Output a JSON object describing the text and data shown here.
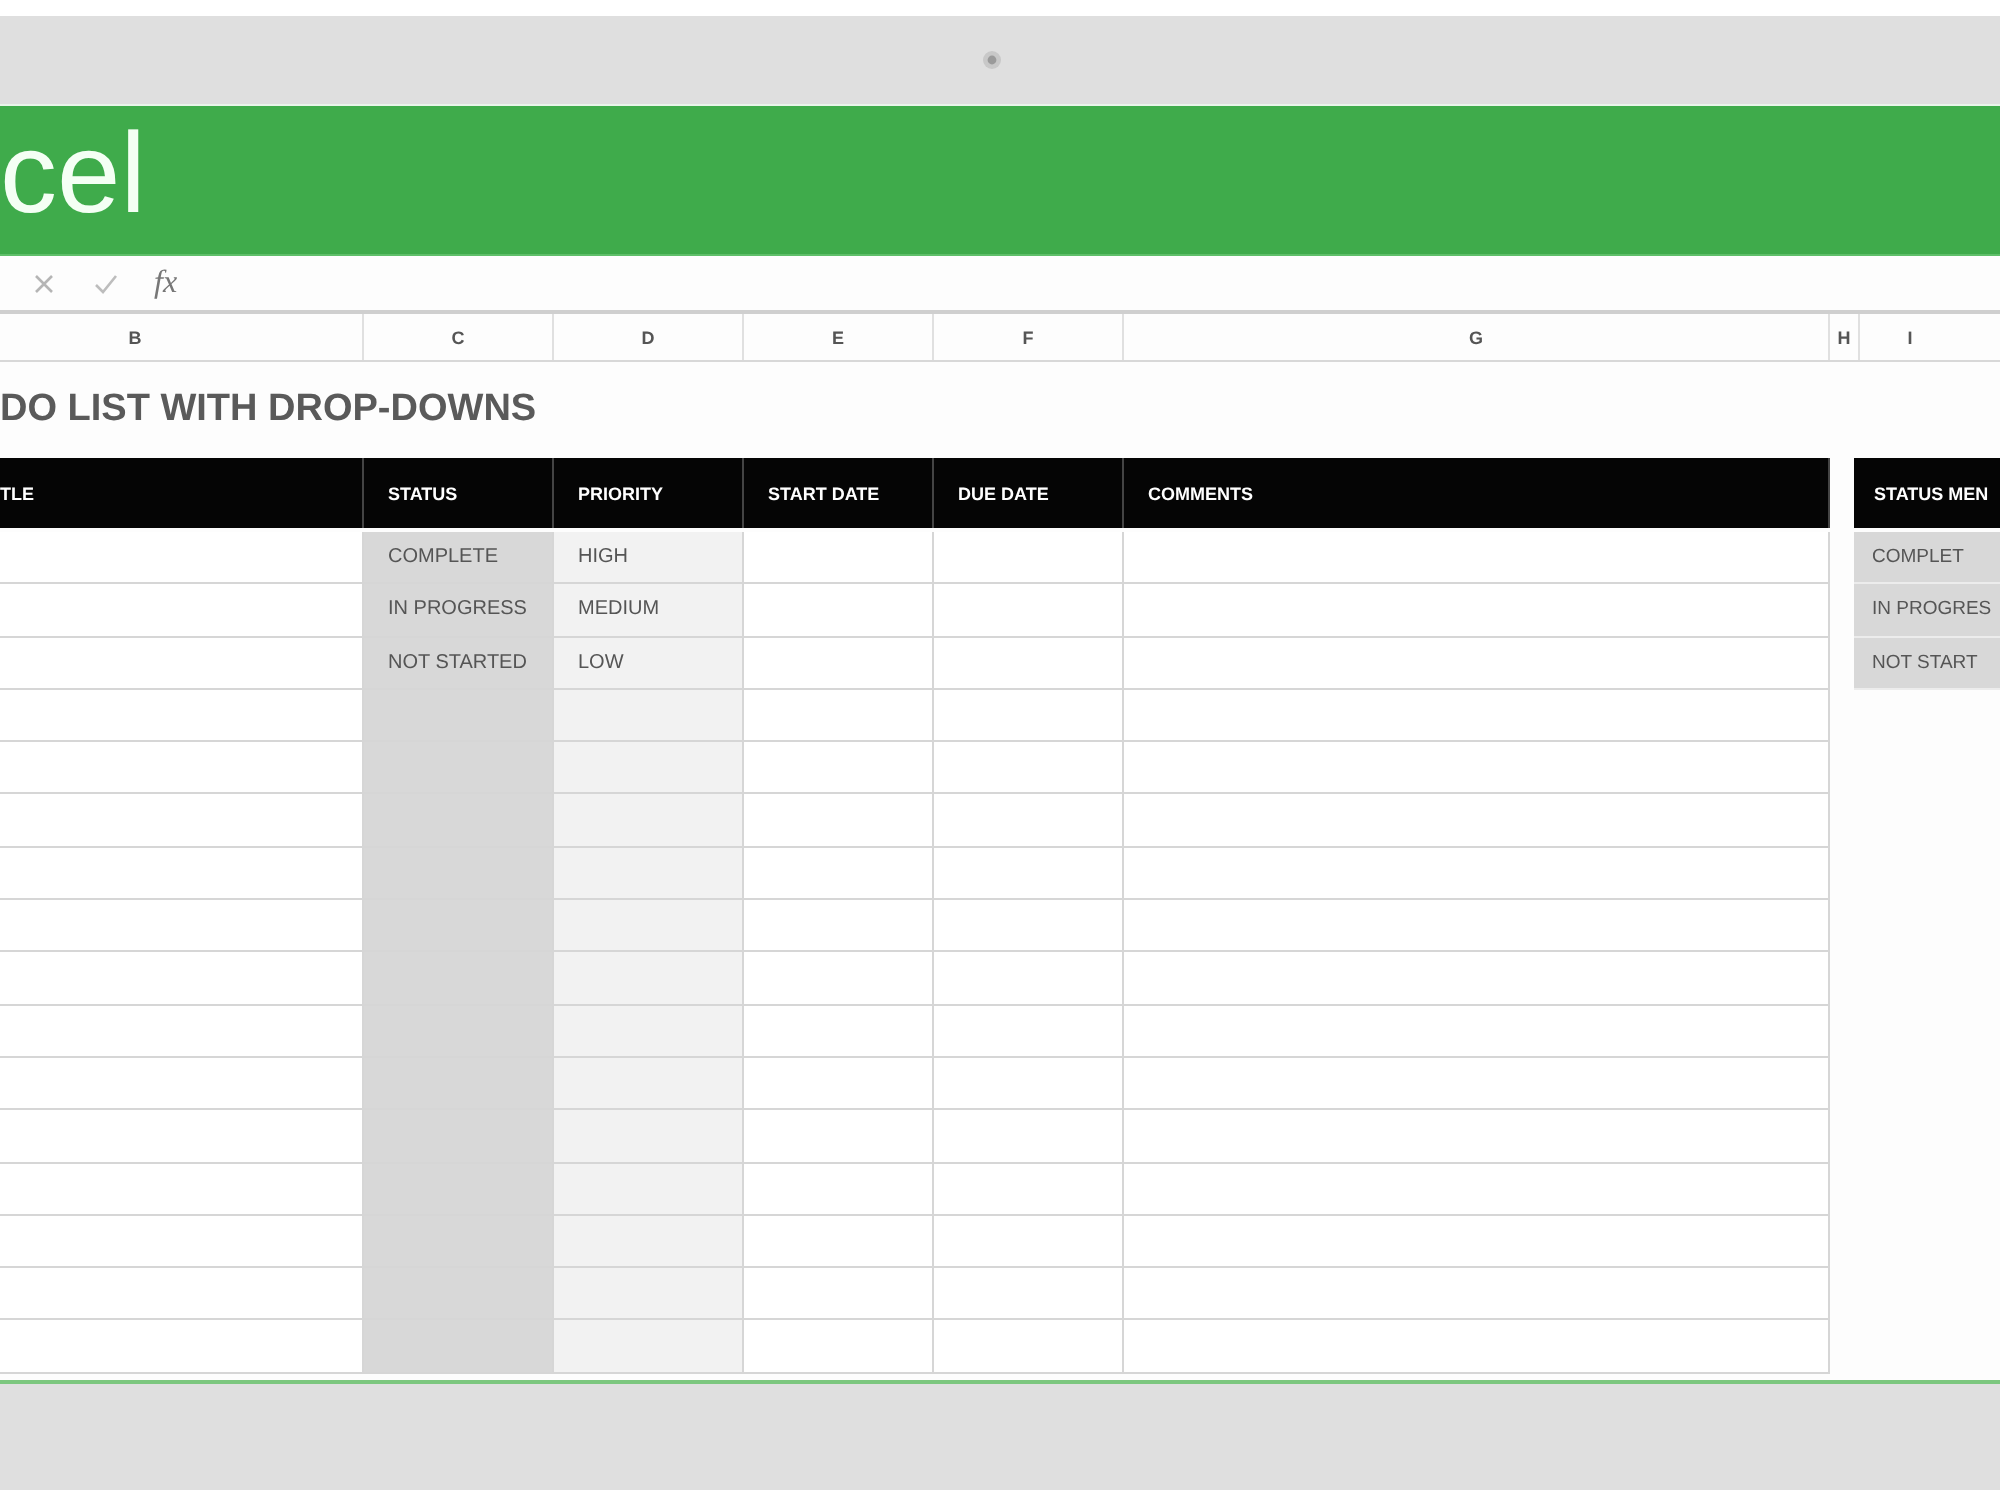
{
  "app": {
    "title": "cel"
  },
  "formula_bar": {
    "function_label": "fx"
  },
  "column_headers": [
    "B",
    "C",
    "D",
    "E",
    "F",
    "G",
    "H",
    "I"
  ],
  "sheet_title": "DO LIST WITH DROP-DOWNS",
  "table": {
    "columns": [
      "TLE",
      "STATUS",
      "PRIORITY",
      "START DATE",
      "DUE DATE",
      "COMMENTS"
    ],
    "rows": [
      {
        "status": "COMPLETE",
        "priority": "HIGH"
      },
      {
        "status": "IN PROGRESS",
        "priority": "MEDIUM"
      },
      {
        "status": "NOT STARTED",
        "priority": "LOW"
      },
      {},
      {},
      {},
      {},
      {},
      {},
      {},
      {},
      {},
      {},
      {},
      {},
      {}
    ]
  },
  "status_menu": {
    "title": "STATUS MEN",
    "items": [
      "COMPLET",
      "IN PROGRES",
      "NOT START"
    ]
  }
}
